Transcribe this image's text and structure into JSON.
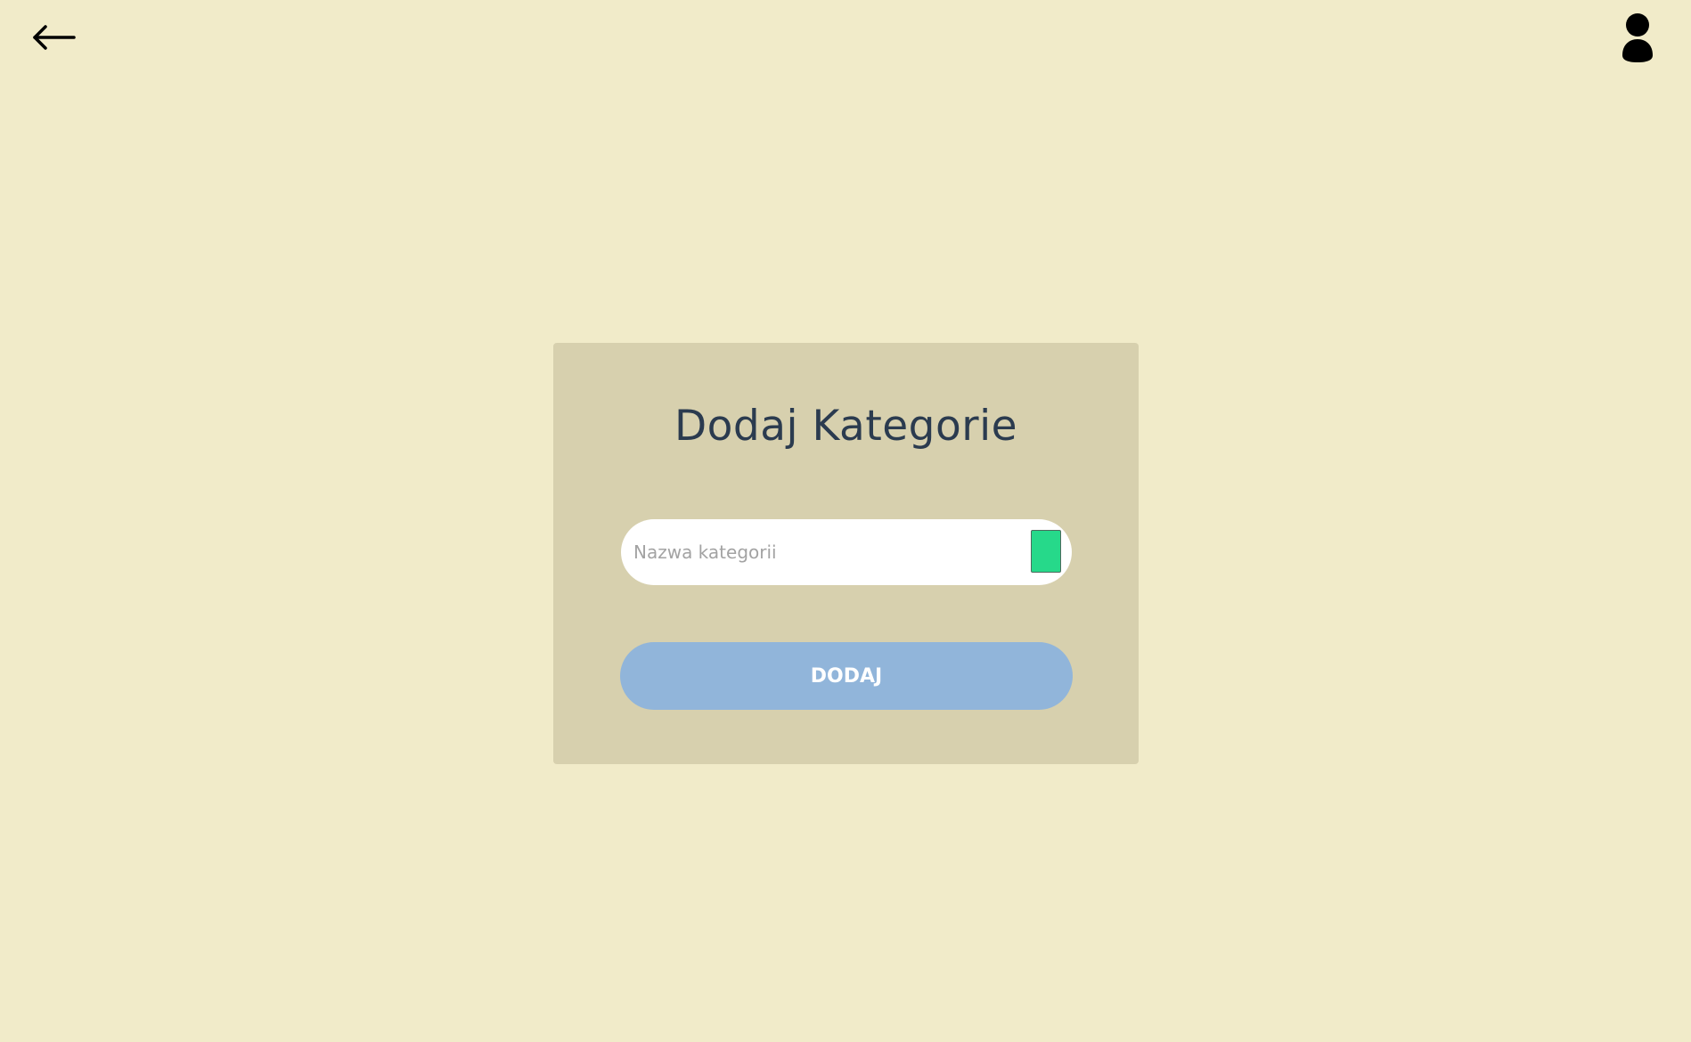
{
  "header": {
    "back_icon": "arrow-left-icon",
    "user_icon": "user-icon"
  },
  "form": {
    "title": "Dodaj Kategorie",
    "name_input": {
      "value": "",
      "placeholder": "Nazwa kategorii"
    },
    "color_picker": {
      "selected_color": "#26d98a"
    },
    "submit_label": "DODAJ"
  },
  "colors": {
    "page_background": "#f1ebc9",
    "card_background": "#d7d0ae",
    "title_text": "#2b3b4f",
    "button_background": "#91b5da",
    "button_text": "#ffffff"
  }
}
